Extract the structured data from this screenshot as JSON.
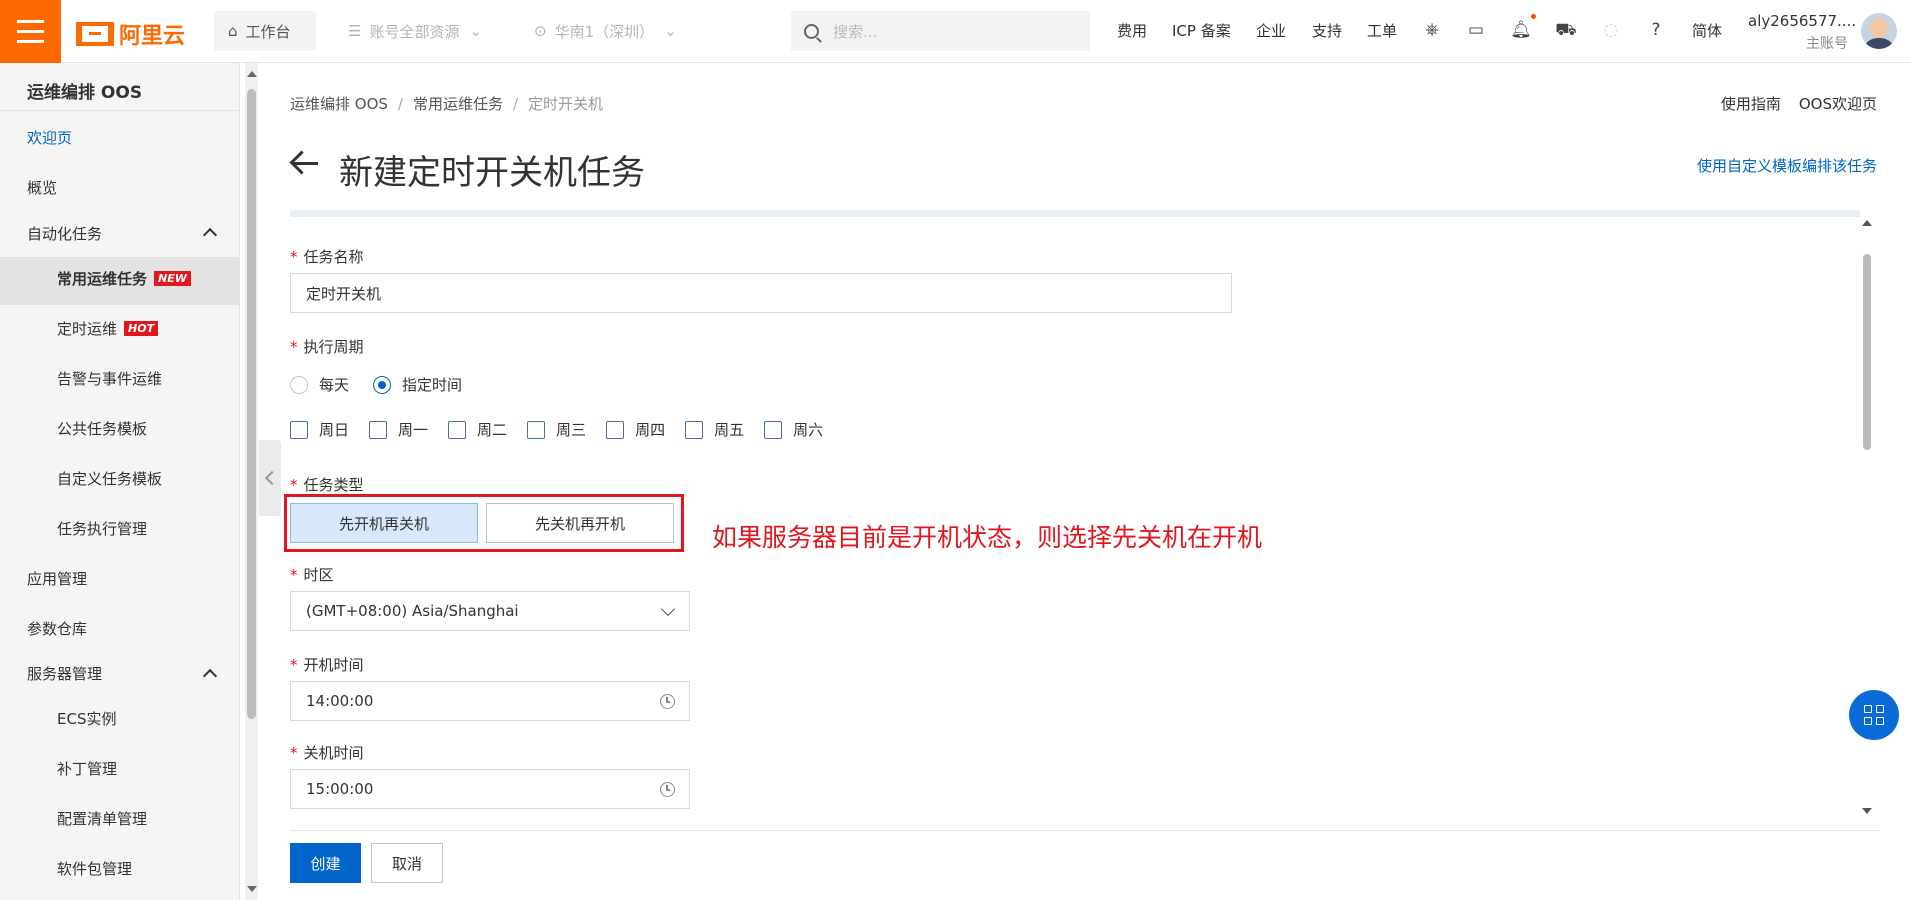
{
  "topbar": {
    "logo_text": "阿里云",
    "workbench": "工作台",
    "resources": "账号全部资源",
    "region": "华南1（深圳）",
    "search_placeholder": "搜索...",
    "nav": [
      "费用",
      "ICP 备案",
      "企业",
      "支持",
      "工单"
    ],
    "language": "简体",
    "account_name": "aly2656577....",
    "account_role": "主账号",
    "icons": [
      "ai-icon",
      "terminal-icon",
      "bell-icon",
      "cart-icon",
      "lightbulb-icon",
      "help-icon"
    ]
  },
  "sidebar": {
    "title": "运维编排 OOS",
    "items": [
      {
        "label": "欢迎页"
      },
      {
        "label": "概览"
      },
      {
        "label": "自动化任务"
      },
      {
        "label": "常用运维任务",
        "badge": "NEW"
      },
      {
        "label": "定时运维",
        "badge": "HOT"
      },
      {
        "label": "告警与事件运维"
      },
      {
        "label": "公共任务模板"
      },
      {
        "label": "自定义任务模板"
      },
      {
        "label": "任务执行管理"
      },
      {
        "label": "应用管理"
      },
      {
        "label": "参数仓库"
      },
      {
        "label": "服务器管理"
      },
      {
        "label": "ECS实例"
      },
      {
        "label": "补丁管理"
      },
      {
        "label": "配置清单管理"
      },
      {
        "label": "软件包管理"
      }
    ]
  },
  "breadcrumb": [
    "运维编排 OOS",
    "常用运维任务",
    "定时开关机"
  ],
  "top_links": [
    "使用指南",
    "OOS欢迎页"
  ],
  "page_title": "新建定时开关机任务",
  "custom_template_link": "使用自定义模板编排该任务",
  "form": {
    "task_name": {
      "label": "任务名称",
      "value": "定时开关机"
    },
    "period": {
      "label": "执行周期",
      "options": [
        "每天",
        "指定时间"
      ],
      "selected": "指定时间",
      "weekdays": [
        "周日",
        "周一",
        "周二",
        "周三",
        "周四",
        "周五",
        "周六"
      ]
    },
    "task_type": {
      "label": "任务类型",
      "options": [
        "先开机再关机",
        "先关机再开机"
      ],
      "selected": "先开机再关机"
    },
    "timezone": {
      "label": "时区",
      "value": "(GMT+08:00) Asia/Shanghai"
    },
    "start_time": {
      "label": "开机时间",
      "value": "14:00:00"
    },
    "stop_time": {
      "label": "关机时间",
      "value": "15:00:00"
    }
  },
  "annotation": "如果服务器目前是开机状态，则选择先关机在开机",
  "buttons": {
    "create": "创建",
    "cancel": "取消"
  },
  "colors": {
    "brand": "#ff6a00",
    "primary": "#0064c8",
    "annotation": "#e3151f"
  }
}
